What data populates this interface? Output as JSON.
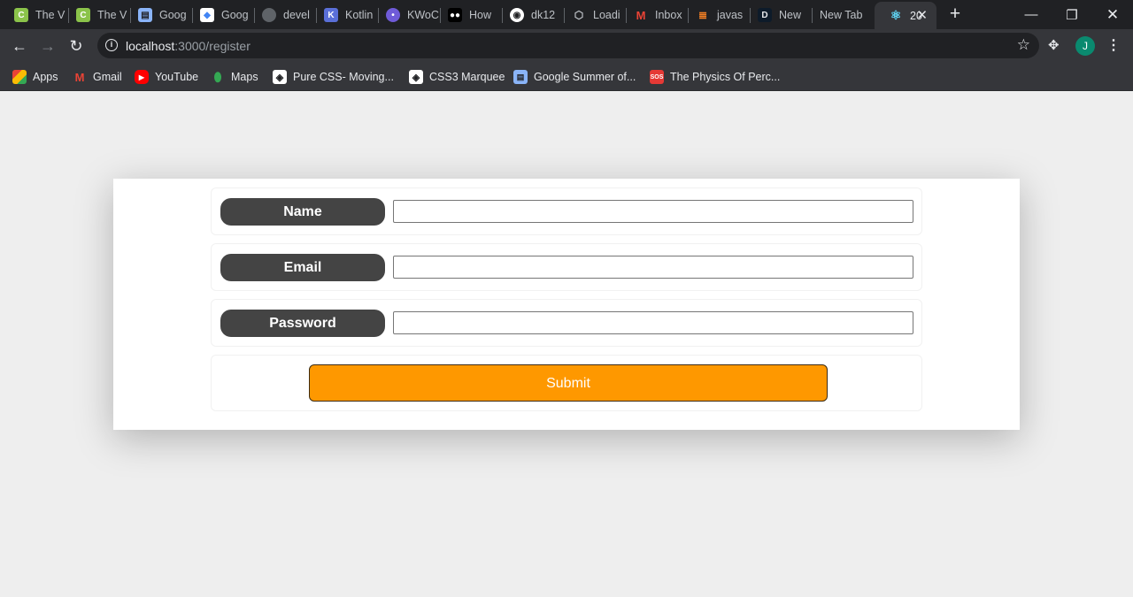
{
  "browser": {
    "tabs": [
      {
        "title": "The V",
        "icon": "c-icon",
        "color": "#8bc34a"
      },
      {
        "title": "The V",
        "icon": "c-icon",
        "color": "#8bc34a"
      },
      {
        "title": "Goog",
        "icon": "doc-icon",
        "color": "#8ab4f8"
      },
      {
        "title": "Goog",
        "icon": "slides-icon",
        "color": "#ffffff"
      },
      {
        "title": "devel",
        "icon": "globe-icon",
        "color": "#5f6368"
      },
      {
        "title": "Kotlin",
        "icon": "k-icon",
        "color": "#5a6fd8"
      },
      {
        "title": "KWoC",
        "icon": "kwoc-icon",
        "color": "#6f5bd8"
      },
      {
        "title": "How",
        "icon": "medium-icon",
        "color": "#ffffff"
      },
      {
        "title": "dk12",
        "icon": "github-icon",
        "color": "#ffffff"
      },
      {
        "title": "Loadi",
        "icon": "cube-icon",
        "color": "#bdc1c6"
      },
      {
        "title": "Inbox",
        "icon": "gmail-icon",
        "color": "#ea4335"
      },
      {
        "title": "javas",
        "icon": "stackoverflow-icon",
        "color": "#f48024"
      },
      {
        "title": "New",
        "icon": "d-icon",
        "color": "#1e88e5"
      },
      {
        "title": "New Tab",
        "icon": "",
        "color": ""
      },
      {
        "title": "20",
        "icon": "react-icon",
        "color": "#61dafb"
      }
    ],
    "address": {
      "host": "localhost",
      "path": ":3000/register"
    },
    "profile_initial": "J",
    "bookmarks": [
      {
        "label": "Apps",
        "icon": "apps-grid-icon"
      },
      {
        "label": "Gmail",
        "icon": "gmail-icon"
      },
      {
        "label": "YouTube",
        "icon": "youtube-icon"
      },
      {
        "label": "Maps",
        "icon": "maps-pin-icon"
      },
      {
        "label": "Pure CSS- Moving...",
        "icon": "codepen-icon"
      },
      {
        "label": "CSS3 Marquee",
        "icon": "codepen-icon"
      },
      {
        "label": "Google Summer of...",
        "icon": "gsoc-icon"
      },
      {
        "label": "The Physics Of Perc...",
        "icon": "sos-icon"
      }
    ]
  },
  "form": {
    "fields": [
      {
        "label": "Name",
        "value": ""
      },
      {
        "label": "Email",
        "value": ""
      },
      {
        "label": "Password",
        "value": ""
      }
    ],
    "submit_label": "Submit"
  },
  "colors": {
    "submit_bg": "#fe9800",
    "label_bg": "#444444",
    "page_bg": "#eeeeee"
  }
}
